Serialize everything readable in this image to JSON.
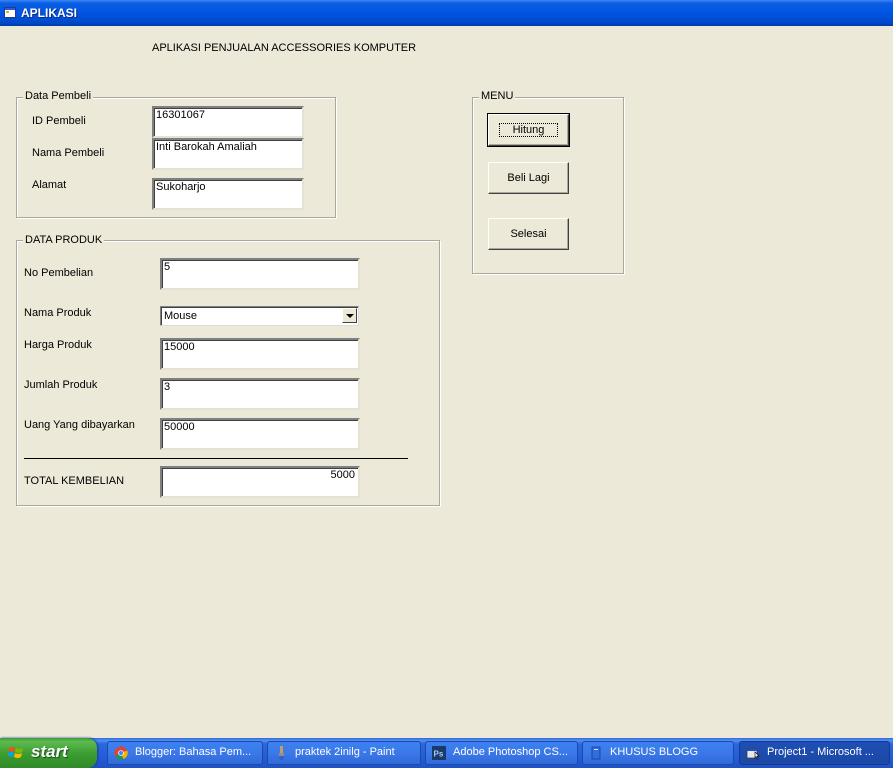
{
  "window": {
    "title": "APLIKASI",
    "heading": "APLIKASI PENJUALAN ACCESSORIES KOMPUTER"
  },
  "data_pembeli": {
    "legend": "Data Pembeli",
    "id_label": "ID Pembeli",
    "id_value": "16301067",
    "nama_label": "Nama Pembeli",
    "nama_value": "Inti Barokah Amaliah",
    "alamat_label": "Alamat",
    "alamat_value": "Sukoharjo"
  },
  "data_produk": {
    "legend": "DATA PRODUK",
    "no_label": "No Pembelian",
    "no_value": "5",
    "nama_label": "Nama Produk",
    "nama_value": "Mouse",
    "harga_label": "Harga Produk",
    "harga_value": "15000",
    "jumlah_label": "Jumlah Produk",
    "jumlah_value": "3",
    "uang_label": "Uang Yang dibayarkan",
    "uang_value": "50000",
    "total_label": "TOTAL KEMBELIAN",
    "total_value": "5000"
  },
  "menu": {
    "legend": "MENU",
    "hitung": "Hitung",
    "beli_lagi": "Beli Lagi",
    "selesai": "Selesai"
  },
  "taskbar": {
    "start": "start",
    "items": [
      {
        "label": "Blogger: Bahasa Pem...",
        "icon": "chrome-icon"
      },
      {
        "label": "praktek  2inilg - Paint",
        "icon": "paint-icon"
      },
      {
        "label": "Adobe Photoshop CS...",
        "icon": "photoshop-icon"
      },
      {
        "label": "KHUSUS BLOGG",
        "icon": "folder-icon"
      },
      {
        "label": "Project1 - Microsoft ...",
        "icon": "visual-basic-icon"
      }
    ]
  },
  "colors": {
    "window_bg": "#ece9d8",
    "titlebar": "#0053e0",
    "taskbar": "#245edb",
    "start_button": "#3c9e31"
  }
}
